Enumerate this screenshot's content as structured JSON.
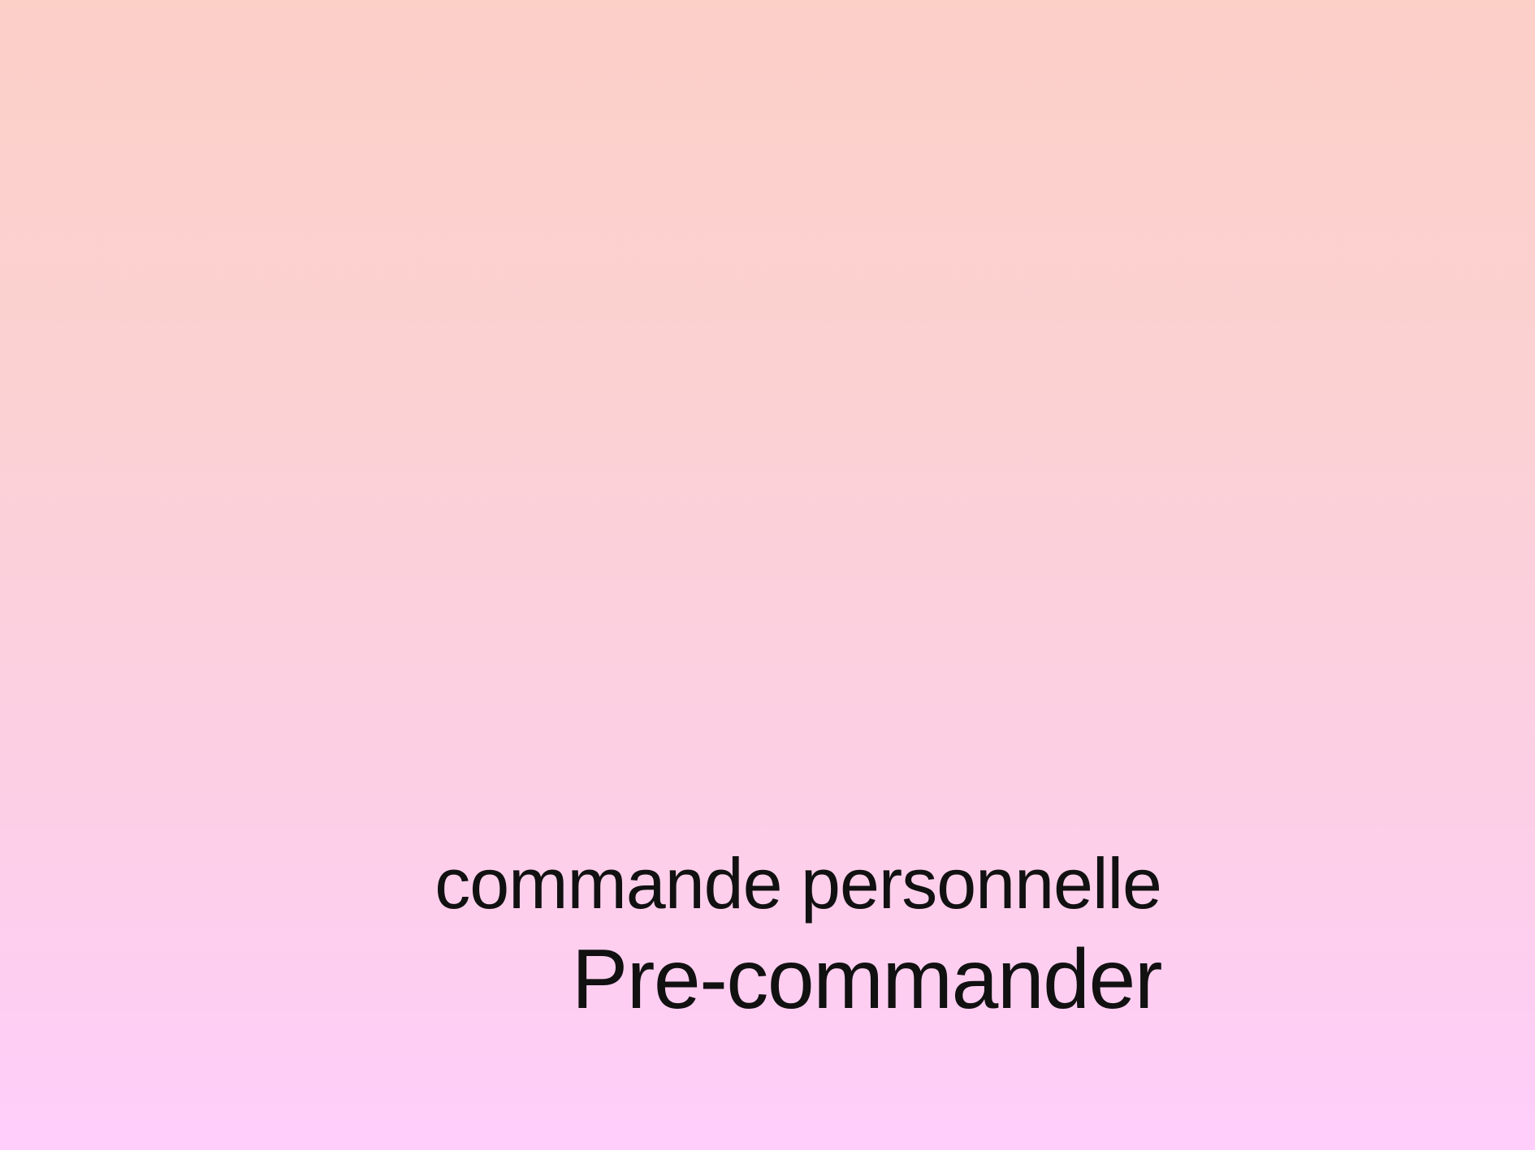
{
  "hero": {
    "subtitle": "commande personnelle",
    "cta_label": "Pre-commander"
  },
  "colors": {
    "background_top": "#fcd0c7",
    "background_bottom": "#ffcefb",
    "text": "#111111"
  }
}
